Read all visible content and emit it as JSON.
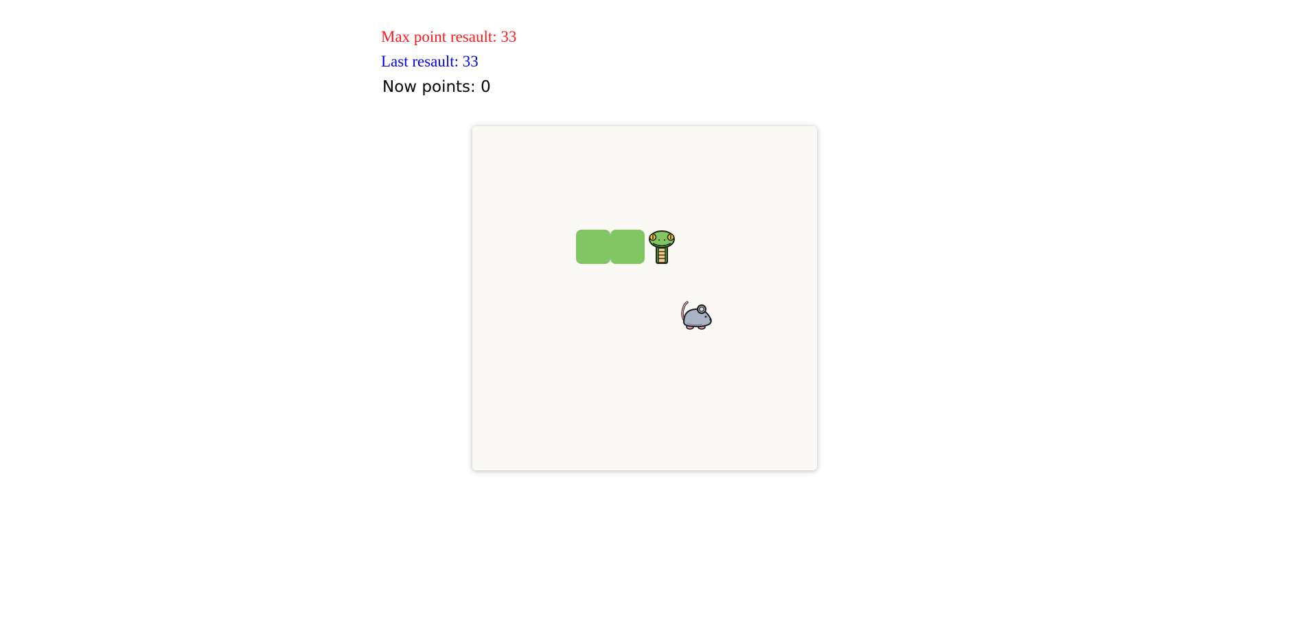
{
  "scores": {
    "max_label": "Max point resault: 33",
    "last_label": "Last resault: 33",
    "now_label": "Now points: 0"
  },
  "board": {
    "grid_size": 10,
    "background": "#faf9f6",
    "snake_color": "#82c563",
    "snake_cells": [
      [
        3,
        3
      ],
      [
        4,
        3
      ],
      [
        5,
        3
      ]
    ],
    "snake_head_icon": "snake-head-icon",
    "food_cell": [
      6,
      5
    ],
    "food_icon": "mouse-icon"
  }
}
